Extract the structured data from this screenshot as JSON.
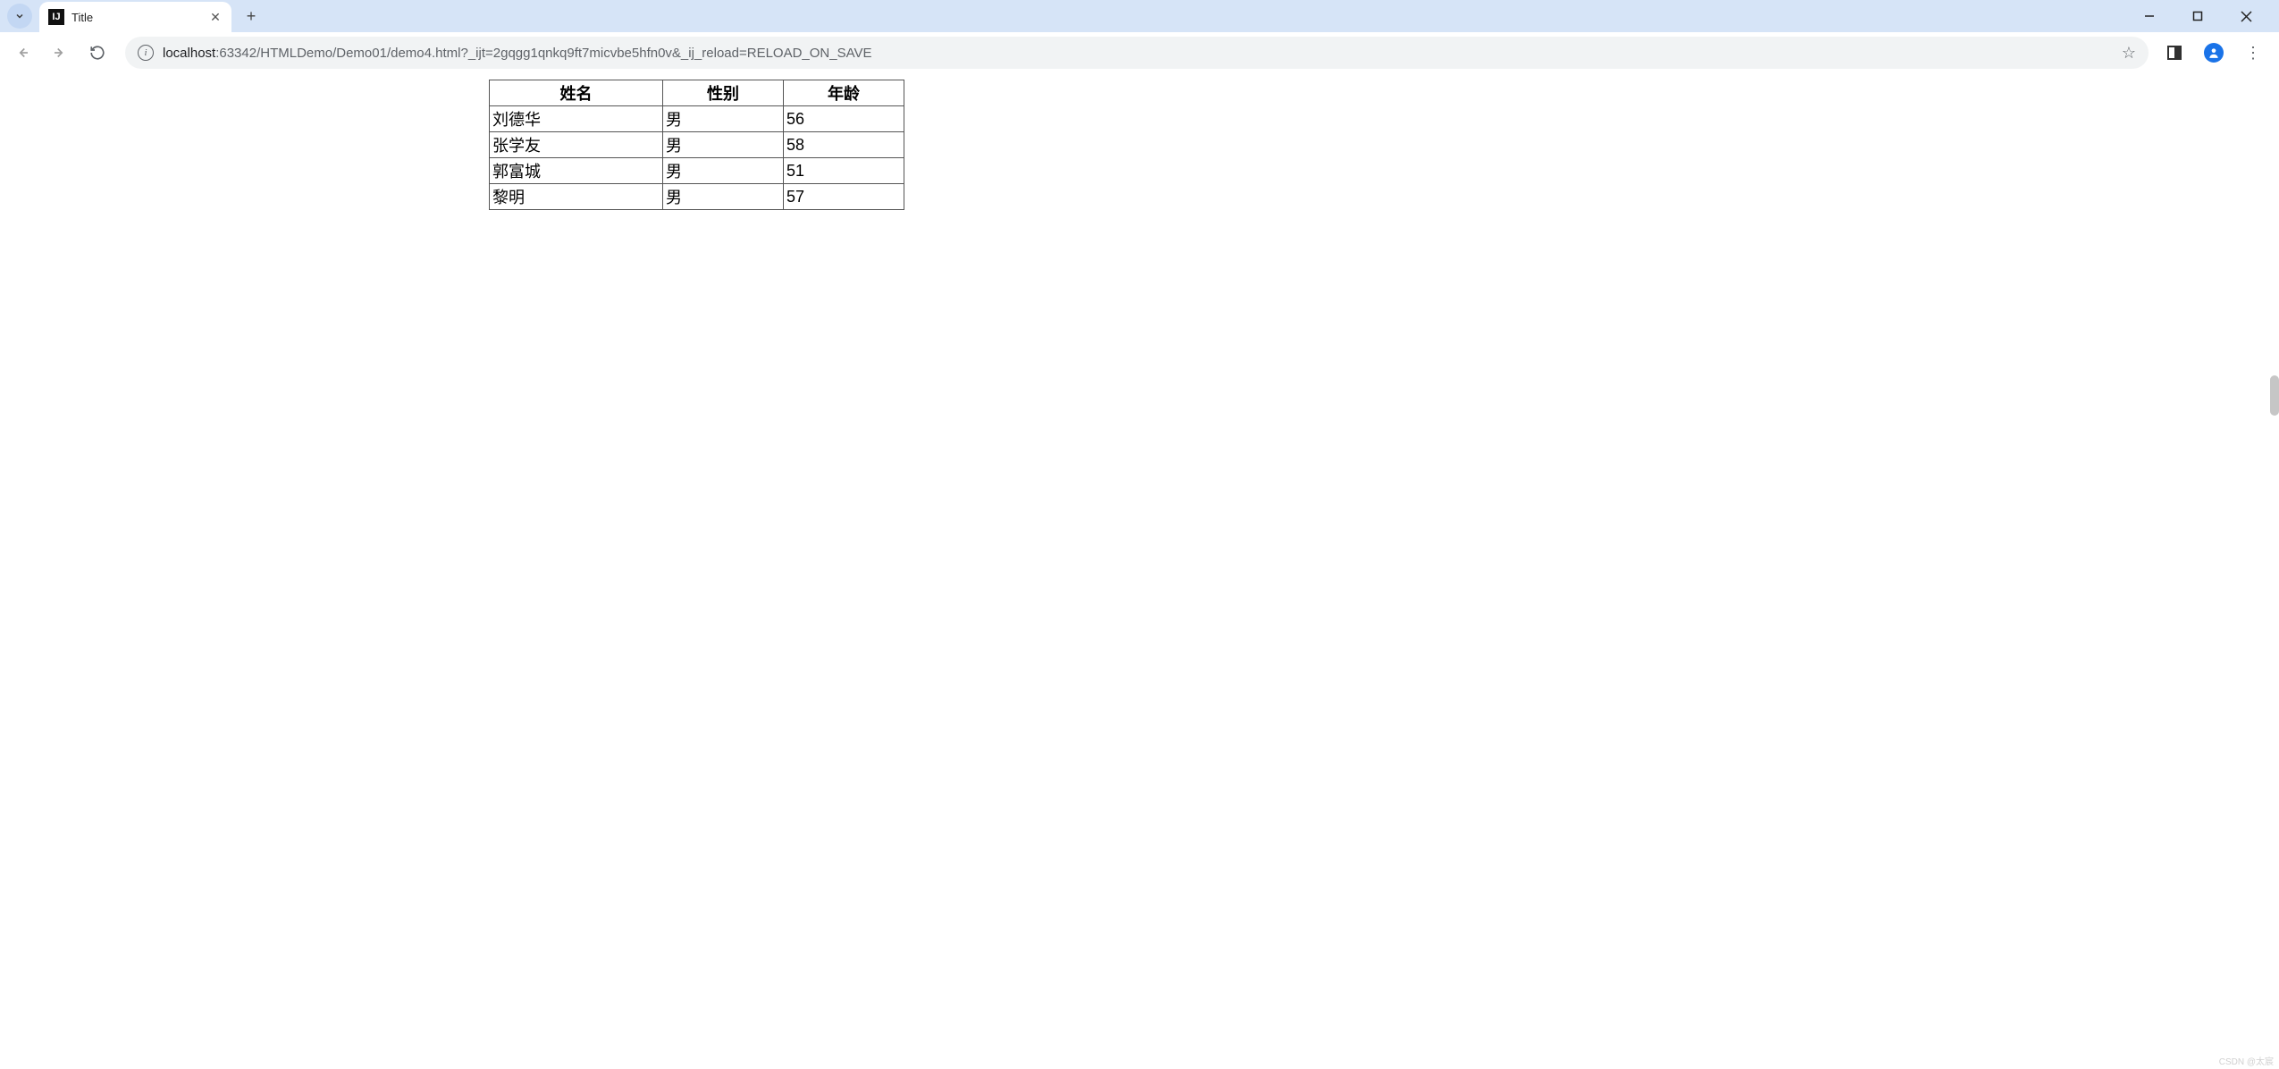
{
  "window": {
    "tab_title": "Title",
    "url_host": "localhost",
    "url_rest": ":63342/HTMLDemo/Demo01/demo4.html?_ijt=2gqgg1qnkq9ft7micvbe5hfn0v&_ij_reload=RELOAD_ON_SAVE"
  },
  "table": {
    "headers": [
      "姓名",
      "性别",
      "年龄"
    ],
    "rows": [
      {
        "name": "刘德华",
        "gender": "男",
        "age": "56"
      },
      {
        "name": "张学友",
        "gender": "男",
        "age": "58"
      },
      {
        "name": "郭富城",
        "gender": "男",
        "age": "51"
      },
      {
        "name": "黎明",
        "gender": "男",
        "age": "57"
      }
    ]
  },
  "watermark": "CSDN @太宸"
}
